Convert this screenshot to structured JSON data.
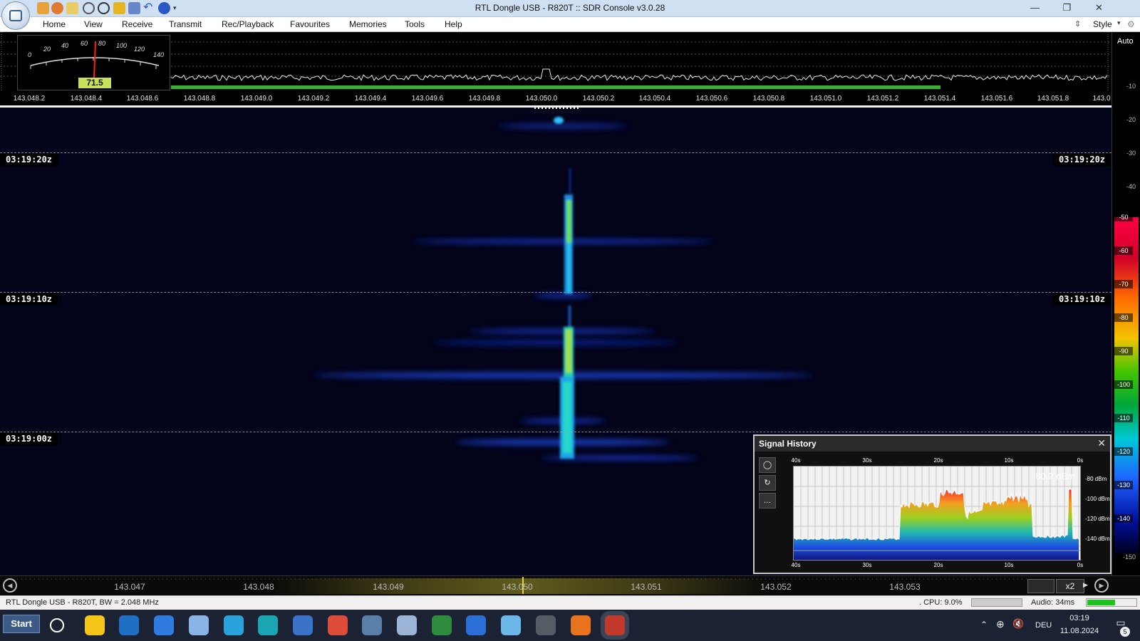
{
  "window": {
    "title": "RTL Dongle USB - R820T :: SDR Console v3.0.28",
    "buttons": {
      "minimize": "—",
      "maximize": "❐",
      "close": "✕"
    }
  },
  "menu": {
    "items": [
      "Home",
      "View",
      "Receive",
      "Transmit",
      "Rec/Playback",
      "Favourites",
      "Memories",
      "Tools",
      "Help"
    ],
    "style_label": "Style"
  },
  "smeter": {
    "scale": [
      "0",
      "20",
      "40",
      "60",
      "80",
      "100",
      "120",
      "140"
    ],
    "value": "71.5"
  },
  "spectrum": {
    "freq_ticks": [
      "143.048.2",
      "143.048.4",
      "143.048.6",
      "143.048.8",
      "143.049.0",
      "143.049.2",
      "143.049.4",
      "143.049.6",
      "143.049.8",
      "143.050.0",
      "143.050.2",
      "143.050.4",
      "143.050.6",
      "143.050.8",
      "143.051.0",
      "143.051.2",
      "143.051.4",
      "143.051.6",
      "143.051.8",
      "143.0"
    ]
  },
  "right_scale": {
    "auto_label": "Auto",
    "ticks": [
      "-10",
      "-20",
      "-30",
      "-40",
      "-50",
      "-60",
      "-70",
      "-80",
      "-90",
      "-100",
      "-110",
      "-120",
      "-130",
      "-140",
      "-150"
    ]
  },
  "waterfall": {
    "timestamps": [
      "03:19:20z",
      "03:19:10z",
      "03:19:00z"
    ]
  },
  "signal_history": {
    "title": "Signal History",
    "close": "✕",
    "current_value": "-80.2 dBm",
    "x_labels": [
      "40s",
      "30s",
      "20s",
      "10s",
      "0s"
    ],
    "y_labels": [
      "-80 dBm",
      "-100 dBm",
      "-120 dBm",
      "-140 dBm"
    ],
    "buttons": [
      "◯",
      "↻",
      "…"
    ]
  },
  "bottom_freq": {
    "labels": [
      "143.047",
      "143.048",
      "143.049",
      "143.050",
      "143.051",
      "143.052",
      "143.053"
    ],
    "zoom": "x2"
  },
  "status": {
    "left": "RTL Dongle USB - R820T, BW = 2.048 MHz",
    "cpu": ". CPU: 9.0%",
    "audio": "Audio: 34ms",
    "audio_level": 0.55
  },
  "taskbar": {
    "start": "Start",
    "lang": "DEU",
    "time": "03:19",
    "date": "11.08.2024",
    "notifications": "5",
    "icons": [
      "search-icon",
      "file-explorer-icon",
      "vscode-icon",
      "app-icon",
      "weather-icon",
      "telegram-icon",
      "edge-icon",
      "phone-icon",
      "chrome-icon",
      "network-icon",
      "chat-icon",
      "notes-icon",
      "compass-icon",
      "antenna-icon",
      "window-icon",
      "firefox-icon",
      "sdr-console-icon"
    ],
    "icon_colors": [
      "#ffffff",
      "#f5c518",
      "#1f6fc4",
      "#2f7be0",
      "#8ab3e6",
      "#2aa3dd",
      "#1aa5b3",
      "#3a72c8",
      "#dd4b39",
      "#5a7fa8",
      "#9bb4d6",
      "#2e8b3d",
      "#2b6fd6",
      "#6ab7e8",
      "#555c66",
      "#e8731c",
      "#c0392b"
    ]
  }
}
